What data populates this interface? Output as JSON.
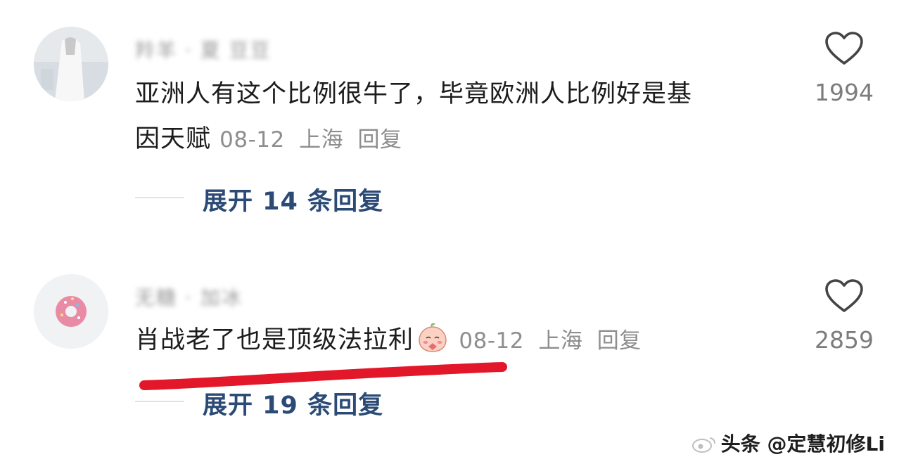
{
  "comments": [
    {
      "username": "羚羊 · 夏 豆豆",
      "text_line1": "亚洲人有这个比例很牛了，毕竟欧洲人比例好是基",
      "text_line2": "因天赋",
      "date": "08-12",
      "location": "上海",
      "reply_label": "回复",
      "likes": "1994",
      "expand_label": "展开 14 条回复"
    },
    {
      "username": "无糖 · 加冰",
      "text": "肖战老了也是顶级法拉利",
      "date": "08-12",
      "location": "上海",
      "reply_label": "回复",
      "likes": "2859",
      "expand_label": "展开 19 条回复"
    }
  ],
  "watermark": "头条 @定慧初修Li",
  "colors": {
    "expand_text": "#2b4a75",
    "meta_text": "#8e8e8e",
    "underline": "#e2172a"
  },
  "icons": {
    "like": "heart-outline-icon",
    "emoji": "peach-emoji-icon"
  }
}
